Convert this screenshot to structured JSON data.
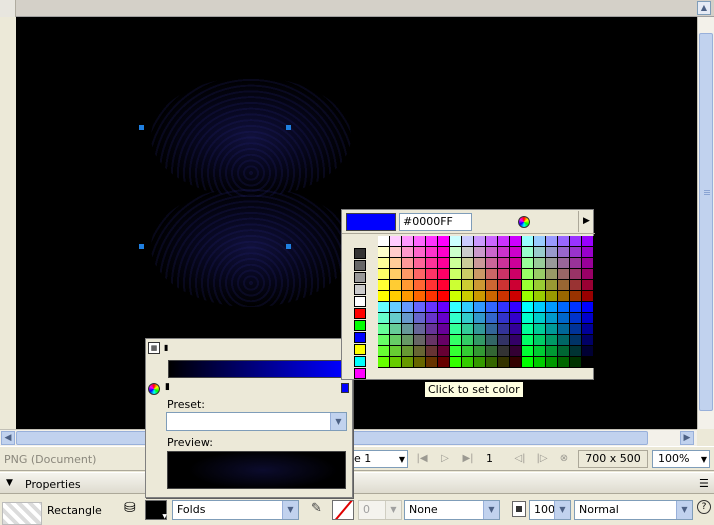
{
  "document": {
    "name": "PNG (Document)"
  },
  "statusbar": {
    "page_combo": "ge 1",
    "page_number": "1",
    "dimensions": "700 x 500",
    "zoom": "100%"
  },
  "properties": {
    "header_label": "Properties",
    "shape_name": "Rectangle",
    "fill_type": "Folds",
    "stroke_width": "0",
    "stroke_style": "None",
    "opacity": "100",
    "blend_mode": "Normal"
  },
  "fill_panel": {
    "preset_label": "Preset:",
    "preset_value": "",
    "preview_label": "Preview:"
  },
  "swatch_popup": {
    "current_color": "#0000FF",
    "hex_value": "#0000FF",
    "side_colors": [
      "#333333",
      "#666666",
      "#999999",
      "#cccccc",
      "#ffffff",
      "#ff0000",
      "#00ff00",
      "#0000ff",
      "#ffff00",
      "#00ffff",
      "#ff00ff"
    ]
  },
  "tooltip": {
    "text": "Click to set color"
  },
  "colors": {
    "accent": "#0000ff",
    "handle": "#1f7fe0"
  }
}
